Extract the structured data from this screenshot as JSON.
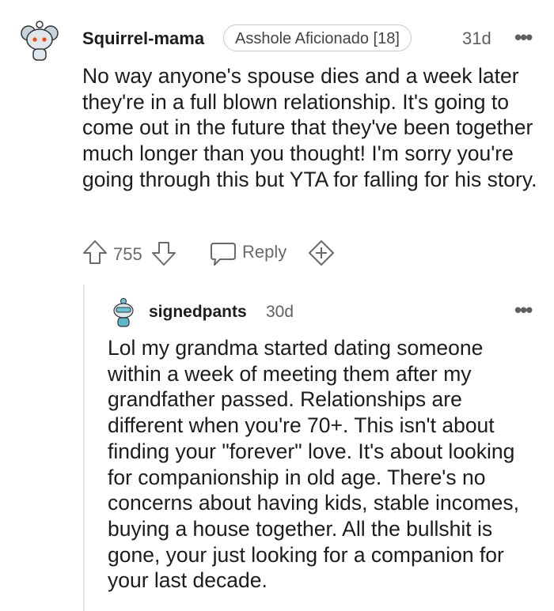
{
  "comment": {
    "username": "Squirrel-mama",
    "flair": "Asshole Aficionado [18]",
    "age": "31d",
    "more": "•••",
    "body": "No way anyone's spouse dies and a week later they're in a full blown relationship. It's going to come out in the future that they've been together much longer than you thought! I'm sorry you're going through this but YTA for falling for his story.",
    "votes": "755",
    "reply_label": "Reply"
  },
  "reply": {
    "username": "signedpants",
    "age": "30d",
    "more": "•••",
    "body": "Lol my grandma started dating someone within a week of meeting them after my grandfather passed. Relationships are different when you're 70+. This isn't about finding your \"forever\" love. It's about looking for companionship in old age. There's no concerns about having kids, stable incomes, buying a house together. All the bullshit is gone, your just looking for a companion for your last decade."
  },
  "icons": {
    "upvote": "upvote-arrow-icon",
    "downvote": "downvote-arrow-icon",
    "reply": "speech-bubble-icon",
    "award": "award-plus-icon"
  }
}
